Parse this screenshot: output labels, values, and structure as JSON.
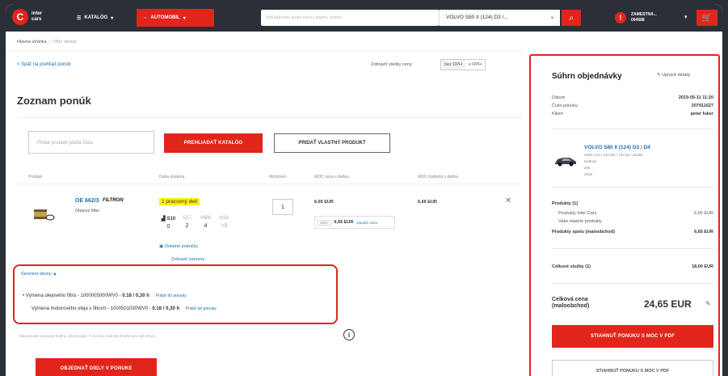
{
  "header": {
    "logo_text": "inter\ncars",
    "nav_katalog": "KATALÓG",
    "nav_auto": "AUTOMOBIL",
    "search_placeholder": "Vyhľadávanie podľa názvu, popisu, indexu",
    "vehicle": "VOLVO S80 II (124) D3 /...",
    "user_label": "ZAMESTNA...",
    "user_id": "004588"
  },
  "breadcrumb": {
    "home": "Hlavná stránka",
    "current": "Offer details"
  },
  "back_link": "< Späť na prehľad ponúk",
  "vat": {
    "label": "Zobraziť všetky ceny",
    "options": [
      "bez DPH",
      "s DPH"
    ]
  },
  "page_title": "Zoznam ponúk",
  "add_product_placeholder": "Pridať produkt podľa čísla",
  "btn_catalog": "PREHLIADAŤ KATALÓG",
  "btn_own_product": "PRIDAŤ VLASTNÝ PRODUKT",
  "table_headers": [
    "Produkt",
    "Doba dodania",
    "Množstvo",
    "MOC cena s daňou",
    "MOC hodnota s daňou"
  ],
  "product": {
    "code": "OE 662/3",
    "brand": "FILTRON",
    "name": "Olejový filter",
    "delivery": "1 pracovný deň",
    "stock_headers": [
      "S10",
      "S17",
      "HBN",
      "H2A"
    ],
    "stock_values": [
      "0",
      "2",
      "4",
      ">9"
    ],
    "stores_link": "Ostatné pobočky",
    "changes_link": "Zobraziť zámeny",
    "qty": "1",
    "unit_price": "6,65 EUR",
    "moc_tag": "MOC",
    "moc_price": "6,65 EUR",
    "edit_price": "Upraviť cenu",
    "total_price": "6,65 EUR",
    "remove": "✕"
  },
  "services": {
    "toggle": "Servisné úkony ▲",
    "lines": [
      {
        "text": "Výmena olejového filtra - 1000005000WV0 - ",
        "time": "0.18 / 0,30 h",
        "add": "Pridať do ponuky",
        "bullet": "•"
      },
      {
        "text": "Výmena motorového oleja s filtrom - 1000501030WV0 - ",
        "time": "0.18 / 0,30 h",
        "add": "Pridať do ponuky",
        "bullet": ""
      }
    ]
  },
  "note": "Odporúčané pracovné hodiny. Skontrolujte, či sú tieto hodnoty vhodné pre váš servis.",
  "btn_order": "OBJEDNAŤ DIELY V PONUKE",
  "summary": {
    "title": "Súhrn objednávky",
    "edit": "Upraviť detaily",
    "rows": [
      {
        "label": "Dátum",
        "value": "2019-05-11 11:20"
      },
      {
        "label": "Číslo ponuky",
        "value": "207911627"
      },
      {
        "label": "Klient",
        "value": "peter fuker"
      }
    ],
    "car_name": "VOLVO S80 II (124) D3 / D4",
    "car_specs": [
      "2400 ccm / 120 kW / 163 hp / Sedan",
      "Naftový",
      "205",
      "2015"
    ],
    "products_label": "Produkty (1)",
    "product_rows": [
      {
        "label": "Produkty Inter Cars",
        "value": "6,65 EUR"
      },
      {
        "label": "Vaše vlastné produkty",
        "value": "-"
      }
    ],
    "products_total_label": "Produkty spolu (maloobchod)",
    "products_total_value": "6,65 EUR",
    "services_label": "Celkové služby (1)",
    "services_value": "18,00 EUR",
    "grand_label": "Celková cena (maloobchod)",
    "grand_value": "24,65 EUR",
    "btn_pdf": "STIAHNUŤ PONUKU S MOC V PDF",
    "btn_pdf2": "STIAHNUŤ PONUKU S MOC V PDF"
  },
  "colors": {
    "brand_red": "#e1251b",
    "link_blue": "#1a6fb5",
    "topbar": "#2b3038"
  }
}
